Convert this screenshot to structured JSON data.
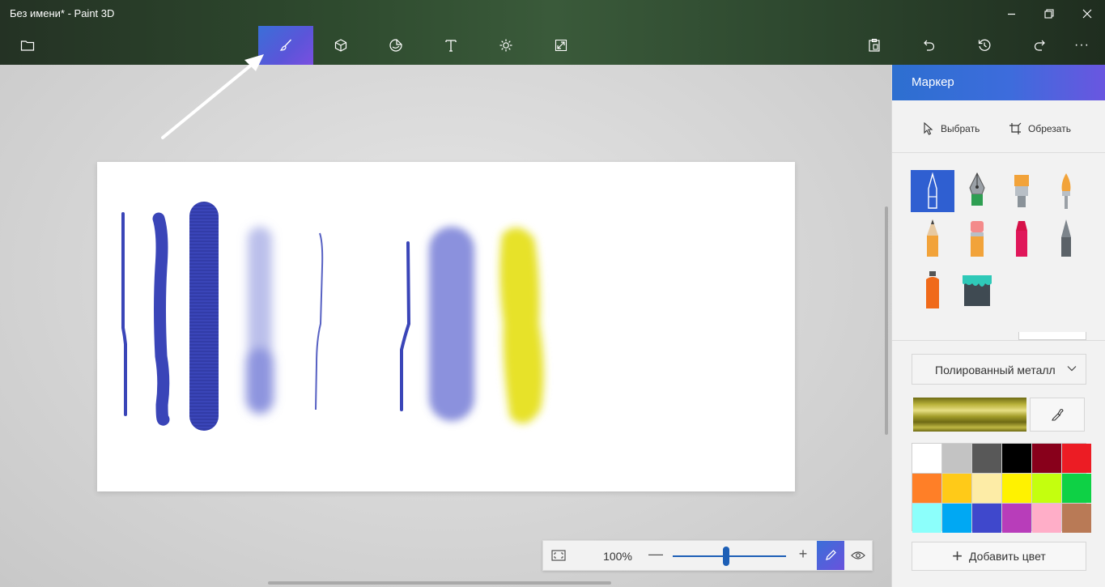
{
  "window": {
    "title": "Без имени* - Paint 3D",
    "minimize": "—",
    "restore": "❐",
    "close": "✕"
  },
  "toolbar": {
    "tools": [
      {
        "name": "menu",
        "icon": "folder-icon"
      },
      {
        "name": "brushes",
        "icon": "brush-icon",
        "active": true
      },
      {
        "name": "3d-shapes",
        "icon": "cube-icon"
      },
      {
        "name": "stickers",
        "icon": "sticker-icon"
      },
      {
        "name": "text",
        "icon": "text-icon"
      },
      {
        "name": "effects",
        "icon": "sun-icon"
      },
      {
        "name": "canvas",
        "icon": "resize-icon"
      }
    ],
    "right_tools": [
      "paste-icon",
      "undo-icon",
      "history-icon",
      "redo-icon",
      "more-icon"
    ],
    "more_label": "···"
  },
  "panel": {
    "title": "Маркер",
    "select_label": "Выбрать",
    "crop_label": "Обрезать",
    "brushes": [
      {
        "name": "marker",
        "selected": true
      },
      {
        "name": "calligraphy-pen"
      },
      {
        "name": "oil-brush"
      },
      {
        "name": "watercolor"
      },
      {
        "name": "pencil"
      },
      {
        "name": "eraser"
      },
      {
        "name": "crayon"
      },
      {
        "name": "pixel-pen"
      },
      {
        "name": "spray-can"
      },
      {
        "name": "fill"
      }
    ],
    "material": "Полированный металл",
    "palette": [
      "#ffffff",
      "#c3c3c3",
      "#585858",
      "#000000",
      "#88001b",
      "#ec1c24",
      "#ff7f27",
      "#ffca18",
      "#fdeca6",
      "#fff200",
      "#c4ff0e",
      "#0ed145",
      "#8cfffb",
      "#00a8f3",
      "#3f48cc",
      "#b83dba",
      "#ffaec8",
      "#b97a56"
    ],
    "add_color_label": "Добавить цвет"
  },
  "zoom": {
    "percent": "100%",
    "level": 0.47,
    "minus": "—",
    "plus": "+"
  },
  "colors": {
    "accent": "#3d6cdc",
    "stroke_blue": "#3a45b8",
    "stroke_yellow": "#e6e01a"
  }
}
